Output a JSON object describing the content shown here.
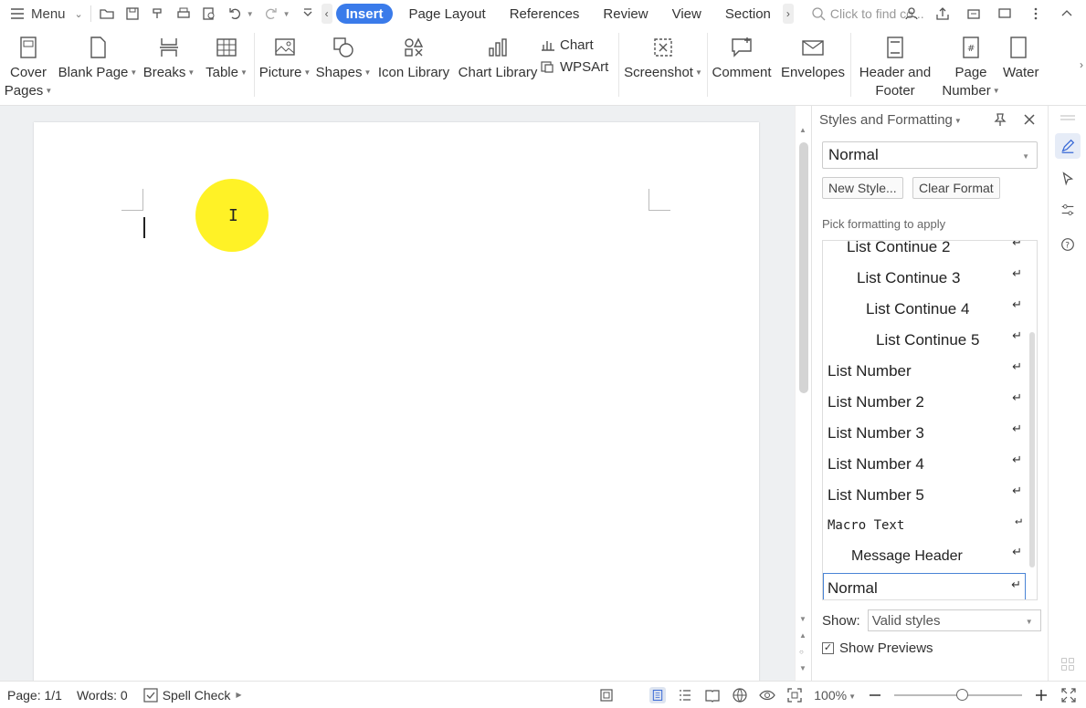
{
  "topbar": {
    "menu_label": "Menu",
    "tabs": [
      "Insert",
      "Page Layout",
      "References",
      "Review",
      "View",
      "Section"
    ],
    "active_tab": "Insert",
    "search_placeholder": "Click to find co..."
  },
  "ribbon": {
    "cover_pages": "Cover Pages",
    "cover_pages_l1": "Cover",
    "cover_pages_l2": "Pages",
    "blank_page": "Blank Page",
    "breaks": "Breaks",
    "table": "Table",
    "picture": "Picture",
    "shapes": "Shapes",
    "icon_library": "Icon Library",
    "chart_library": "Chart Library",
    "chart": "Chart",
    "wpsart": "WPSArt",
    "screenshot": "Screenshot",
    "comment": "Comment",
    "envelopes": "Envelopes",
    "header_footer_l1": "Header and",
    "header_footer_l2": "Footer",
    "page_number_l1": "Page",
    "page_number_l2": "Number",
    "watermark": "Water"
  },
  "pane": {
    "title": "Styles and Formatting",
    "current_style": "Normal",
    "new_style_btn": "New Style...",
    "clear_format_btn": "Clear Format",
    "pick_label": "Pick formatting to apply",
    "styles": [
      {
        "name": "List Continue 2",
        "indent": 1
      },
      {
        "name": "List Continue 3",
        "indent": 2
      },
      {
        "name": "List Continue 4",
        "indent": 3
      },
      {
        "name": "List Continue 5",
        "indent": 4
      },
      {
        "name": "List Number",
        "indent": 0
      },
      {
        "name": "List Number 2",
        "indent": 0
      },
      {
        "name": "List Number 3",
        "indent": 0
      },
      {
        "name": "List Number 4",
        "indent": 0
      },
      {
        "name": "List Number 5",
        "indent": 0
      },
      {
        "name": "Macro Text",
        "indent": 0
      },
      {
        "name": "Message Header",
        "indent": 1
      },
      {
        "name": "Normal",
        "indent": 0
      }
    ],
    "selected_style": "Normal",
    "return_symbol": "↵",
    "show_label": "Show:",
    "show_value": "Valid styles",
    "show_previews_label": "Show Previews",
    "show_previews_checked": true
  },
  "status": {
    "page": "Page: 1/1",
    "words": "Words: 0",
    "spell_check": "Spell Check",
    "zoom": "100%"
  },
  "colors": {
    "accent": "#3a7bea",
    "highlight": "#fff000"
  }
}
